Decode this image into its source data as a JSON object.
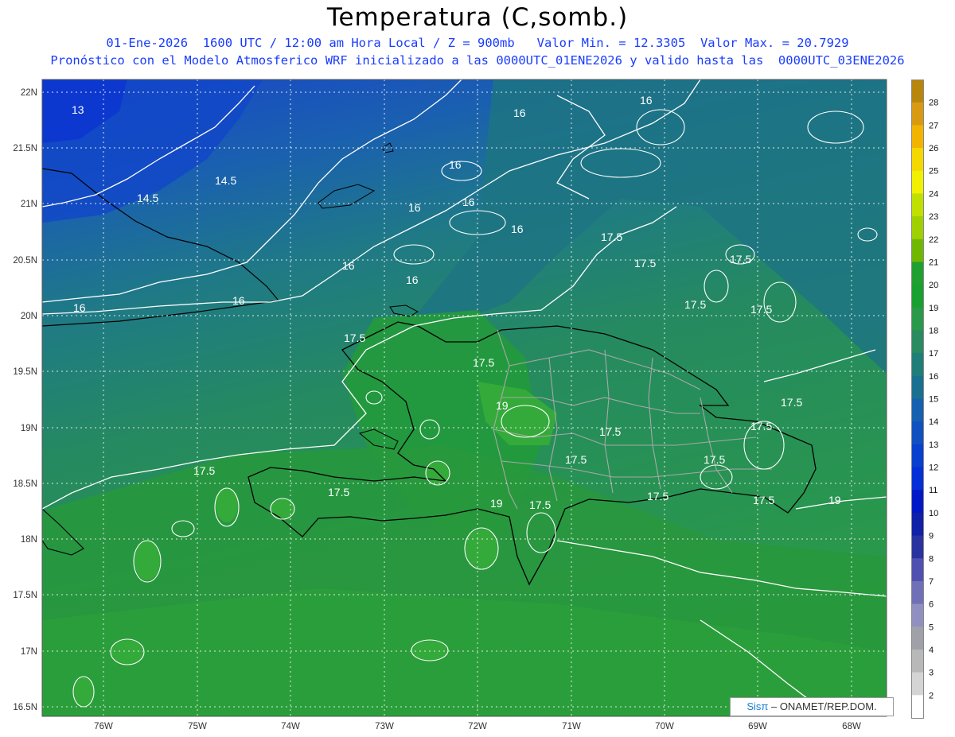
{
  "header": {
    "title": "Temperatura (C,somb.)",
    "line1": "01-Ene-2026  1600 UTC / 12:00 am Hora Local / Z = 900mb   Valor Min. = 12.3305  Valor Max. = 20.7929",
    "line2": "Pronóstico con el Modelo Atmosferico WRF inicializado a las 0000UTC_01ENE2026 y valido hasta las  0000UTC_03ENE2026"
  },
  "axes": {
    "lat_labels": [
      "22N",
      "21.5N",
      "21N",
      "20.5N",
      "20N",
      "19.5N",
      "19N",
      "18.5N",
      "18N",
      "17.5N",
      "17N",
      "16.5N"
    ],
    "lon_labels": [
      "76W",
      "75W",
      "74W",
      "73W",
      "72W",
      "71W",
      "70W",
      "69W",
      "68W"
    ]
  },
  "colorbar": {
    "labels": [
      "28",
      "27",
      "26",
      "25",
      "24",
      "23",
      "22",
      "21",
      "20",
      "19",
      "18",
      "17",
      "16",
      "15",
      "14",
      "13",
      "12",
      "11",
      "10",
      "9",
      "8",
      "7",
      "6",
      "5",
      "4",
      "3",
      "2"
    ],
    "colors": [
      "#b8860b",
      "#d99a12",
      "#f2b400",
      "#f5d800",
      "#f0f000",
      "#c0e000",
      "#a0d000",
      "#70b800",
      "#20a030",
      "#18a030",
      "#2a9a4a",
      "#2a8a60",
      "#1f7f78",
      "#1a7090",
      "#1560b0",
      "#1050c0",
      "#0a40d0",
      "#0530d8",
      "#0018c8",
      "#1020a8",
      "#2a32a0",
      "#5050b0",
      "#7070b8",
      "#9090c0",
      "#a0a0a8",
      "#b8b8b8",
      "#d4d4d4",
      "#ffffff"
    ]
  },
  "contour_labels": [
    "13",
    "14.5",
    "14.5",
    "16",
    "16",
    "16",
    "16",
    "16",
    "16",
    "16",
    "16",
    "16",
    "16",
    "17.5",
    "17.5",
    "17.5",
    "17.5",
    "17.5",
    "17.5",
    "17.5",
    "17.5",
    "17.5",
    "17.5",
    "17.5",
    "17.5",
    "17.5",
    "17.5",
    "17.5",
    "17.5",
    "17.5",
    "19",
    "19",
    "19"
  ],
  "credit": {
    "brand": "Sisπ",
    "text": " – ONAMET/REP.DOM."
  }
}
